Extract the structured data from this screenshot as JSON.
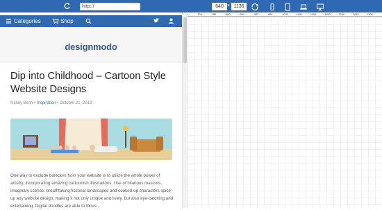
{
  "toolbar": {
    "url_value": "http://",
    "width_value": "640",
    "height_value": "1136",
    "times_symbol": "×"
  },
  "ruler": {
    "labels": [
      "650",
      "700",
      "750",
      "800",
      "850",
      "900",
      "950",
      "1000",
      "1050",
      "1100",
      "1150",
      "1200",
      "1250",
      "1300"
    ]
  },
  "phone_nav": {
    "categories_label": "Categories",
    "shop_label": "Shop"
  },
  "logo_text": "designmodo",
  "article": {
    "title": "Dip into Childhood – Cartoon Style Website Designs",
    "author": "Nataly Birch",
    "category": "Inspiration",
    "date": "October 21, 2013",
    "body": "One way to exclude boredom from your website is to utilize the whole power of artistry, incorporating amazing cartoonish illustrations. Use of hilarious mascots, imaginary scenes, breathtaking fictional landscapes and cooked-up characters spice up any website design, making it not only unique and lively, but also eye-catching and entertaining. Digital doodles are able to focus..."
  },
  "colors": {
    "brand_blue": "#2f69b3",
    "link_blue": "#3b6fb3"
  }
}
